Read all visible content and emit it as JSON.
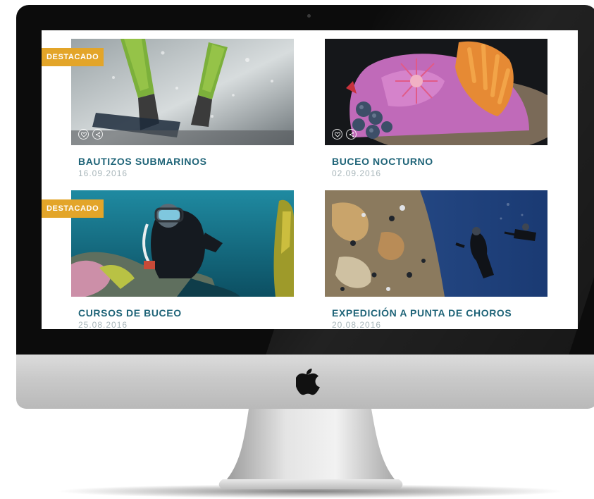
{
  "colors": {
    "accent_badge": "#e3a529",
    "title": "#1f6478",
    "date": "#a8b6ba"
  },
  "featured_label": "DESTACADO",
  "posts": [
    {
      "title": "BAUTIZOS SUBMARINOS",
      "date": "16.09.2016",
      "featured": true,
      "image": "fins-underwater-photo"
    },
    {
      "title": "BUCEO NOCTURNO",
      "date": "02.09.2016",
      "featured": false,
      "image": "coral-anemone-photo"
    },
    {
      "title": "CURSOS DE BUCEO",
      "date": "25.08.2016",
      "featured": true,
      "image": "diver-portrait-photo"
    },
    {
      "title": "EXPEDICIÓN A PUNTA DE CHOROS",
      "date": "20.08.2016",
      "featured": false,
      "image": "reef-divers-photo"
    }
  ],
  "card_actions": {
    "like_icon": "heart-icon",
    "share_icon": "share-icon"
  }
}
